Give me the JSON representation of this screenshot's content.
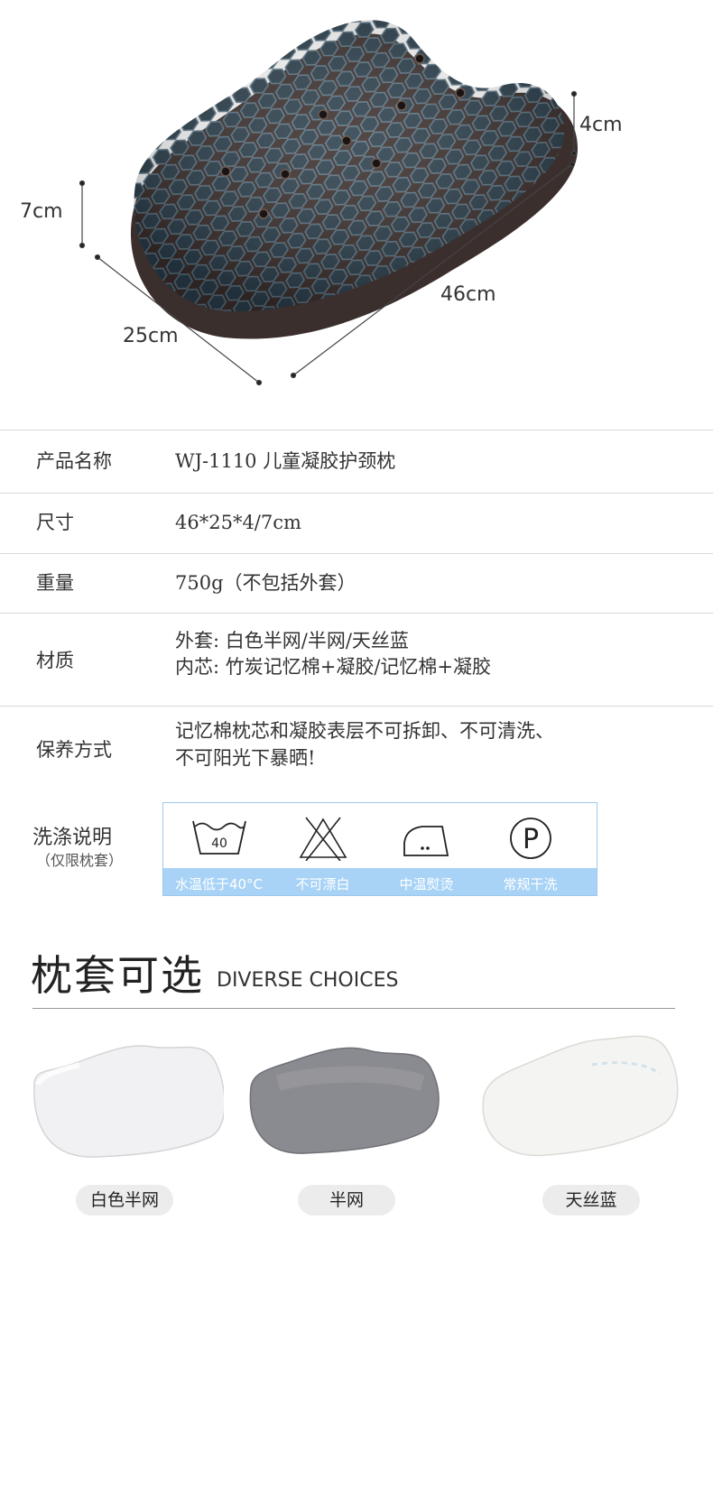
{
  "hero": {
    "dimensions": {
      "height_back": "7cm",
      "height_front": "4cm",
      "depth": "25cm",
      "length": "46cm"
    }
  },
  "specs": [
    {
      "label": "产品名称",
      "value": "WJ-1110 儿童凝胶护颈枕"
    },
    {
      "label": "尺寸",
      "value": "46*25*4/7cm"
    },
    {
      "label": "重量",
      "value": "750g（不包括外套）"
    },
    {
      "label": "材质",
      "value_lines": [
        "外套: 白色半网/半网/天丝蓝",
        "内芯: 竹炭记忆棉+凝胶/记忆棉+凝胶"
      ]
    },
    {
      "label": "保养方式",
      "value_lines": [
        "记忆棉枕芯和凝胶表层不可拆卸、不可清洗、",
        "不可阳光下暴晒!"
      ]
    }
  ],
  "wash": {
    "label": "洗涤说明",
    "sub": "（仅限枕套）",
    "items": [
      {
        "icon": "wash-40-icon",
        "icon_text": "40",
        "caption": "水温低于40°C"
      },
      {
        "icon": "no-bleach-icon",
        "caption": "不可漂白"
      },
      {
        "icon": "iron-medium-icon",
        "caption": "中温熨烫"
      },
      {
        "icon": "dry-clean-p-icon",
        "icon_text": "P",
        "caption": "常规干洗"
      }
    ]
  },
  "choices": {
    "title": "枕套可选",
    "subtitle": "DIVERSE CHOICES",
    "options": [
      {
        "label": "白色半网",
        "color": "#f1f1f3"
      },
      {
        "label": "半网",
        "color": "#8a8b90"
      },
      {
        "label": "天丝蓝",
        "color": "#f4f5f2"
      }
    ]
  }
}
